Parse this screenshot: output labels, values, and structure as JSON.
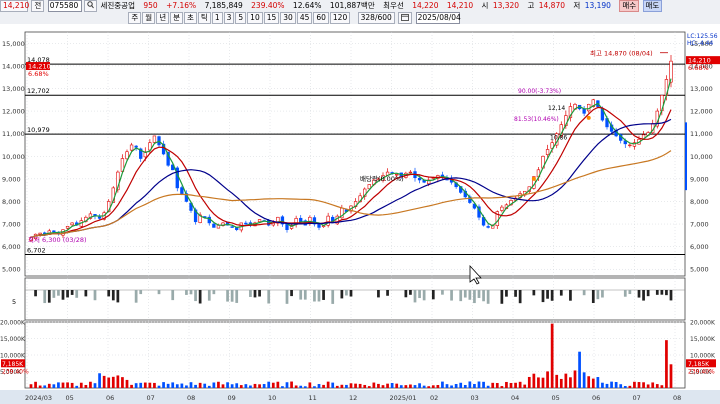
{
  "toolbar": {
    "row1": {
      "price_box": "14,210",
      "market_select": "전",
      "code": "075580",
      "lookup_icon": "search-icon",
      "company": "세진중공업",
      "change": "950",
      "change_pct": "+7.16%",
      "volume": "7,185,849",
      "volume_ratio": "239.40%",
      "turnover": "12.64%",
      "amount": "101,887백만",
      "label_best": "최우선",
      "bid": "14,220",
      "ask": "14,210",
      "label_open": "시",
      "open": "13,320",
      "label_high": "고",
      "high": "14,870",
      "label_low": "저",
      "low": "13,190",
      "buy_label": "매수",
      "sell_label": "매도"
    },
    "row2": {
      "periods": [
        "주",
        "월",
        "년",
        "분",
        "초",
        "틱",
        "1",
        "3",
        "5",
        "10",
        "15",
        "30",
        "45",
        "60",
        "120"
      ],
      "count": "328/600",
      "date": "2025/08/04",
      "calendar_icon": "calendar-icon"
    }
  },
  "colors": {
    "up": "#e10000",
    "down": "#0050ff",
    "ma5": "#1b9a3a",
    "ma20": "#c00000",
    "ma60": "#00008b",
    "ma120": "#c87822"
  },
  "chart_data": [
    {
      "type": "candlestick",
      "panel": "price",
      "ylim": [
        4700,
        15500
      ],
      "yticks": [
        "5,000",
        "6,000",
        "7,000",
        "8,000",
        "9,000",
        "10,000",
        "11,000",
        "12,000",
        "13,000",
        "14,000",
        "15,000"
      ],
      "xtick_labels": [
        "2024/03",
        "05",
        "06",
        "07",
        "08",
        "09",
        "10",
        "11",
        "12",
        "2025/01",
        "02",
        "03",
        "04",
        "05",
        "06",
        "07",
        "08"
      ],
      "hlines": [
        {
          "value": 14078,
          "label": "14,078"
        },
        {
          "value": 12702,
          "label": "12,702"
        },
        {
          "value": 10979,
          "label": "10,979"
        },
        {
          "value": 5650,
          "label": ""
        }
      ],
      "annotations": [
        {
          "text": "최고 14,870 (08/04)",
          "color": "#c00000"
        },
        {
          "text": "최저 6,300 (03/28)",
          "color": "#b000b0"
        },
        {
          "text": "배당락(0.00%)",
          "color": "#000000"
        },
        {
          "text": "90.00(-3.73%)",
          "color": "#b000b0"
        },
        {
          "text": "81.53(10.46%)",
          "color": "#b000b0"
        },
        {
          "text": "12,14",
          "color": "#000000"
        },
        {
          "text": "10,86",
          "color": "#000000"
        },
        {
          "text": "6,702",
          "color": "#000000"
        }
      ],
      "right_labels": {
        "lc": "LC:125.56",
        "hc": "HC:-4.44",
        "current": "14,210",
        "current_pct": "6.68%"
      },
      "left_labels": {
        "current": "14,210",
        "current_pct": "6.68%"
      },
      "closes": [
        6400,
        6550,
        6600,
        6500,
        6700,
        6650,
        6550,
        6750,
        6900,
        7050,
        6950,
        7150,
        7300,
        7450,
        7350,
        7250,
        7500,
        8000,
        8600,
        9300,
        9900,
        10200,
        10500,
        10400,
        9900,
        10200,
        10600,
        10900,
        10500,
        10100,
        9600,
        9400,
        8600,
        8300,
        8000,
        7600,
        7100,
        7400,
        7300,
        7050,
        6850,
        6950,
        7050,
        6950,
        6850,
        6750,
        7050,
        7000,
        6950,
        7050,
        7200,
        7150,
        6950,
        7050,
        7300,
        7000,
        6750,
        6950,
        7250,
        7100,
        6950,
        7300,
        7000,
        6850,
        6950,
        7350,
        7050,
        7350,
        7700,
        7550,
        7800,
        8000,
        8250,
        8550,
        8750,
        8950,
        9000,
        9150,
        9300,
        9250,
        9200,
        9100,
        9250,
        9300,
        9050,
        8950,
        8850,
        8950,
        9050,
        9150,
        9100,
        8950,
        8850,
        8650,
        8400,
        8200,
        7950,
        7700,
        7300,
        6950,
        6850,
        6950,
        7550,
        7750,
        7850,
        8050,
        8150,
        8350,
        8450,
        8650,
        9100,
        9400,
        10000,
        10300,
        10600,
        11000,
        11400,
        11800,
        12200,
        12300,
        12100,
        11900,
        12300,
        12500,
        12200,
        11600,
        11300,
        11100,
        10900,
        10700,
        10550,
        10500,
        10600,
        10750,
        10950,
        11050,
        11450,
        12000,
        12700,
        13400,
        14210
      ]
    },
    {
      "type": "bar",
      "panel": "indicator",
      "note": "binary up/down signal bars"
    },
    {
      "type": "bar",
      "panel": "volume",
      "yticks": [
        "5,000K",
        "10,000K",
        "15,000K",
        "20,000K"
      ],
      "right_labels": {
        "volume": "7,185K",
        "ratio": "239.40%"
      },
      "left_labels": {
        "volume": "7,185K",
        "ratio": "239.40%"
      },
      "max_value": 20000
    }
  ]
}
